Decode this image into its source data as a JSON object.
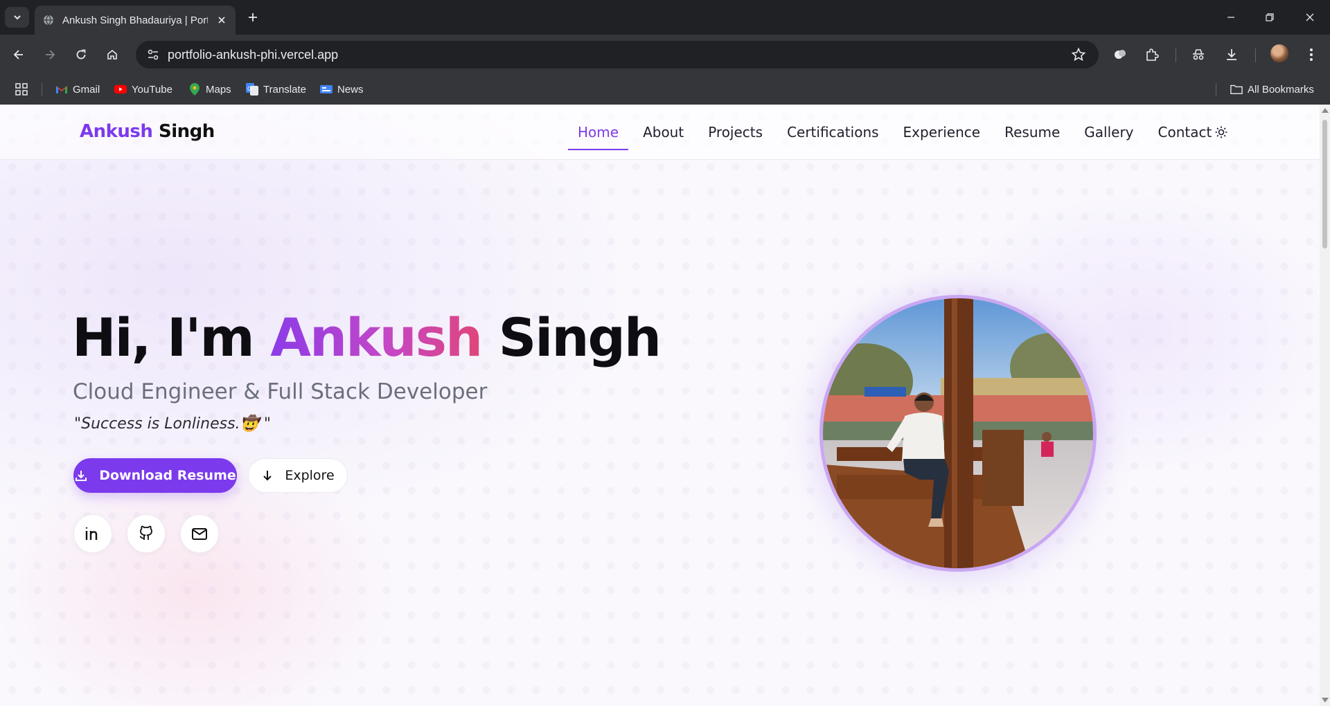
{
  "browser": {
    "tab_title": "Ankush Singh Bhadauriya | Portfolio",
    "url": "portfolio-ankush-phi.vercel.app",
    "bookmarks": [
      {
        "label": "Gmail",
        "icon": "gmail-icon"
      },
      {
        "label": "YouTube",
        "icon": "youtube-icon"
      },
      {
        "label": "Maps",
        "icon": "maps-icon"
      },
      {
        "label": "Translate",
        "icon": "translate-icon"
      },
      {
        "label": "News",
        "icon": "news-icon"
      }
    ],
    "all_bookmarks": "All Bookmarks"
  },
  "site": {
    "brand_first": "Ankush",
    "brand_last": "Singh",
    "nav": [
      "Home",
      "About",
      "Projects",
      "Certifications",
      "Experience",
      "Resume",
      "Gallery",
      "Contact"
    ],
    "active_nav": "Home",
    "accent": "#7c3aed"
  },
  "hero": {
    "greeting": "Hi, I'm ",
    "name_first": "Ankush",
    "name_last": " Singh",
    "subtitle": "Cloud Engineer & Full Stack Developer",
    "quote": "\"Success is Lonliness.🤠 \"",
    "download_label": "Download Resume",
    "explore_label": "Explore",
    "socials": [
      "linkedin-icon",
      "github-icon",
      "mail-icon"
    ]
  }
}
